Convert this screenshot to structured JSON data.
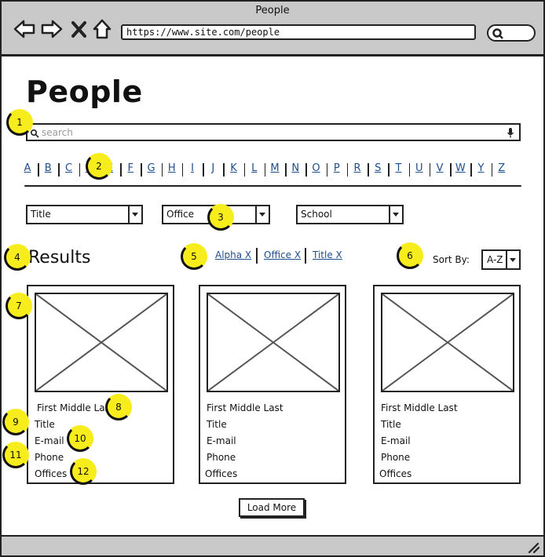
{
  "window": {
    "title": "People",
    "url": "https://www.site.com/people"
  },
  "page": {
    "title": "People"
  },
  "search": {
    "placeholder": "search"
  },
  "alphabet": [
    "A",
    "B",
    "C",
    "D",
    "E",
    "F",
    "G",
    "H",
    "I",
    "J",
    "K",
    "L",
    "M",
    "N",
    "O",
    "P",
    "R",
    "S",
    "T",
    "U",
    "V",
    "W",
    "Y",
    "Z"
  ],
  "filters": {
    "title_label": "Title",
    "office_label": "Office",
    "school_label": "School"
  },
  "results": {
    "heading": "Results",
    "active_filters": [
      "Alpha X",
      "Office X",
      "Title X"
    ],
    "sort_label": "Sort By:",
    "sort_value": "A-Z"
  },
  "cards": [
    {
      "name": "First Middle Last",
      "title": "Title",
      "email": "E-mail",
      "phone": "Phone",
      "offices": "Offices"
    },
    {
      "name": "First Middle Last",
      "title": "Title",
      "email": "E-mail",
      "phone": "Phone",
      "offices": "Offices"
    },
    {
      "name": "First Middle Last",
      "title": "Title",
      "email": "E-mail",
      "phone": "Phone",
      "offices": "Offices"
    }
  ],
  "load_more_label": "Load More",
  "markers": [
    "1",
    "2",
    "3",
    "4",
    "5",
    "6",
    "7",
    "8",
    "9",
    "10",
    "11",
    "12"
  ],
  "colors": {
    "marker": "#f7ec1c",
    "link": "#1f4e8c",
    "chrome": "#c9c9c9"
  },
  "icons": [
    "back-icon",
    "forward-icon",
    "close-icon",
    "home-icon",
    "search-icon",
    "microphone-icon",
    "resize-grip-icon"
  ]
}
